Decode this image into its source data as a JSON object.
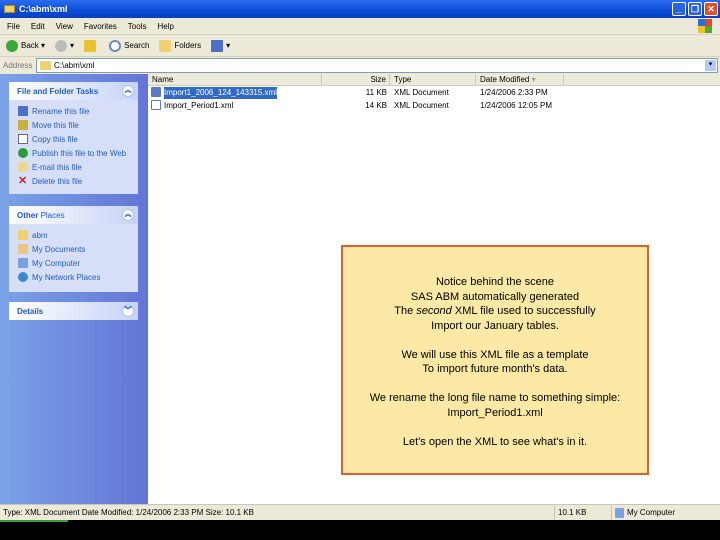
{
  "window": {
    "title": "C:\\abm\\xml"
  },
  "menu": [
    "File",
    "Edit",
    "View",
    "Favorites",
    "Tools",
    "Help"
  ],
  "toolbar": {
    "back": "Back",
    "search": "Search",
    "folders": "Folders"
  },
  "address": {
    "label": "Address",
    "value": "C:\\abm\\xml"
  },
  "sidebar": {
    "tasks": {
      "title": "File and Folder Tasks",
      "items": [
        "Rename this file",
        "Move this file",
        "Copy this file",
        "Publish this file to the Web",
        "E-mail this file",
        "Delete this file"
      ]
    },
    "places": {
      "title_bold": "Other",
      "title_rest": " Places",
      "items": [
        "abm",
        "My Documents",
        "My Computer",
        "My Network Places"
      ]
    },
    "details": {
      "title": "Details"
    }
  },
  "files": {
    "columns": [
      "Name",
      "Size",
      "Type",
      "Date Modified"
    ],
    "rows": [
      {
        "name": "Import1_2006_124_143315.xml",
        "size": "11 KB",
        "type": "XML Document",
        "date": "1/24/2006 2:33 PM",
        "selected": true
      },
      {
        "name": "Import_Period1.xml",
        "size": "14 KB",
        "type": "XML Document",
        "date": "1/24/2006 12:05 PM",
        "selected": false
      }
    ]
  },
  "status": {
    "info": "Type: XML Document Date Modified: 1/24/2006 2:33 PM Size: 10.1 KB",
    "size": "10.1 KB",
    "zone": "My Computer"
  },
  "note": {
    "p1": [
      "Notice behind the scene",
      "SAS ABM automatically generated"
    ],
    "p1_line3_pre": "The ",
    "p1_line3_em": "second",
    "p1_line3_post": " XML file used to successfully",
    "p1_line4": "Import our January tables.",
    "p2": [
      "We will use this XML file as a template",
      "To import future month's data."
    ],
    "p3": [
      "We rename the long file name to something simple:",
      "Import_Period1.xml"
    ],
    "p4": "Let's open the XML to see what's in it."
  }
}
